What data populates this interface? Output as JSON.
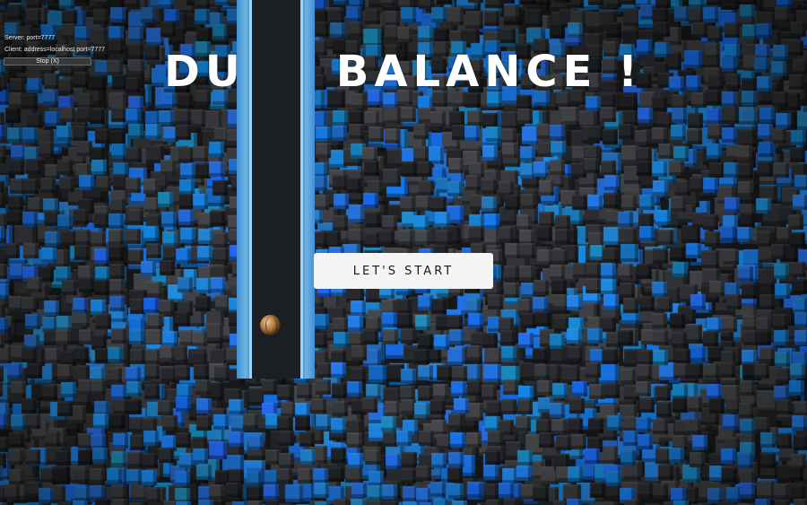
{
  "debug": {
    "server": "Server: port=7777",
    "client": "Client: address=localhost port=7777",
    "stop_label": "Stop (X)"
  },
  "title": "DUAL BALANCE !",
  "start_button": "LET'S START",
  "colors": {
    "cube_blue": "#1f7fd6",
    "cube_dark": "#2c2f33",
    "rail_blue": "#4f9fdc",
    "track_dark": "#1b1f23",
    "button_bg": "#f4f4f4",
    "title": "#ffffff"
  },
  "icons": {
    "ball": "wooden-ball-icon"
  }
}
